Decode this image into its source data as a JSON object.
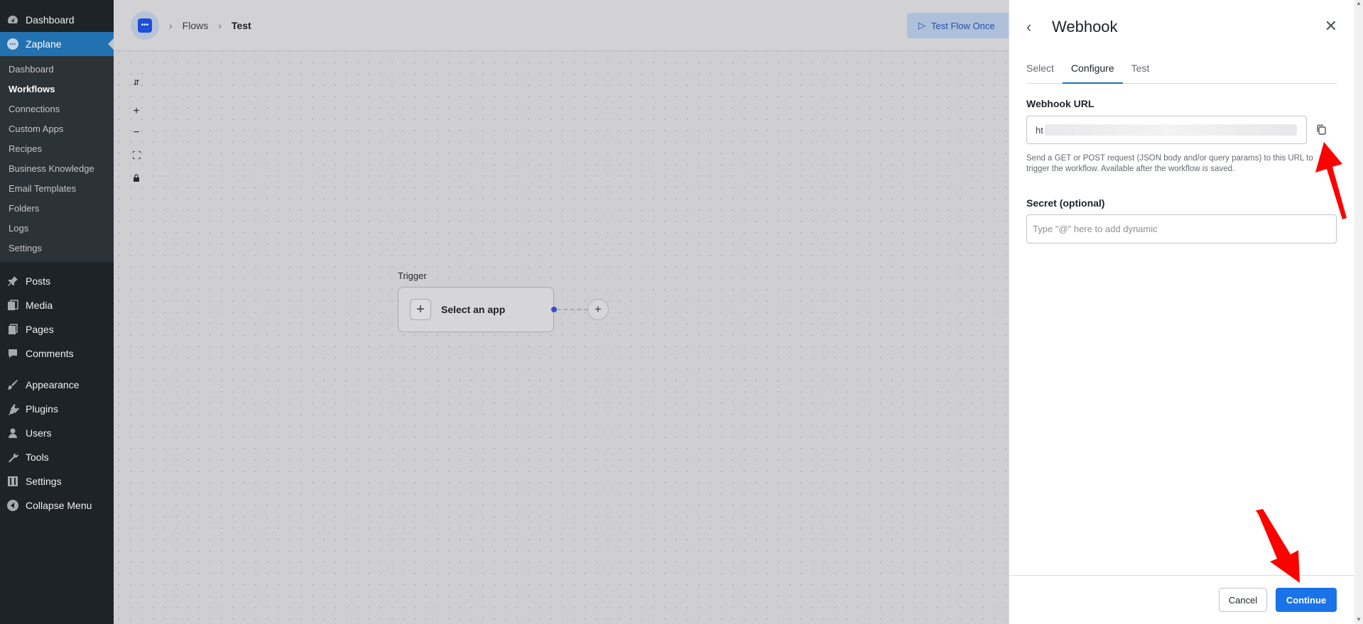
{
  "wp_menu": {
    "dashboard": "Dashboard",
    "zaplane": "Zaplane",
    "zaplane_sub": [
      "Dashboard",
      "Workflows",
      "Connections",
      "Custom Apps",
      "Recipes",
      "Business Knowledge",
      "Email Templates",
      "Folders",
      "Logs",
      "Settings"
    ],
    "posts": "Posts",
    "media": "Media",
    "pages": "Pages",
    "comments": "Comments",
    "appearance": "Appearance",
    "plugins": "Plugins",
    "users": "Users",
    "tools": "Tools",
    "settings": "Settings",
    "collapse": "Collapse Menu"
  },
  "topbar": {
    "breadcrumb": [
      "Flows",
      "Test"
    ],
    "test_flow_button": "Test Flow Once"
  },
  "canvas": {
    "trigger_label": "Trigger",
    "trigger_node_text": "Select an app"
  },
  "panel": {
    "title": "Webhook",
    "tabs": [
      "Select",
      "Configure",
      "Test"
    ],
    "active_tab": "Configure",
    "webhook_url_label": "Webhook URL",
    "webhook_url_value_prefix": "ht",
    "webhook_url_help": "Send a GET or POST request (JSON body and/or query params) to this URL to trigger the workflow. Available after the workflow is saved.",
    "secret_label": "Secret (optional)",
    "secret_placeholder": "Type \"@\" here to add dynamic",
    "cancel_button": "Cancel",
    "continue_button": "Continue"
  },
  "colors": {
    "wp_sidebar": "#1d2327",
    "wp_accent": "#2271b1",
    "primary_button": "#1a73e8",
    "annotation_arrow": "#ff0000"
  }
}
